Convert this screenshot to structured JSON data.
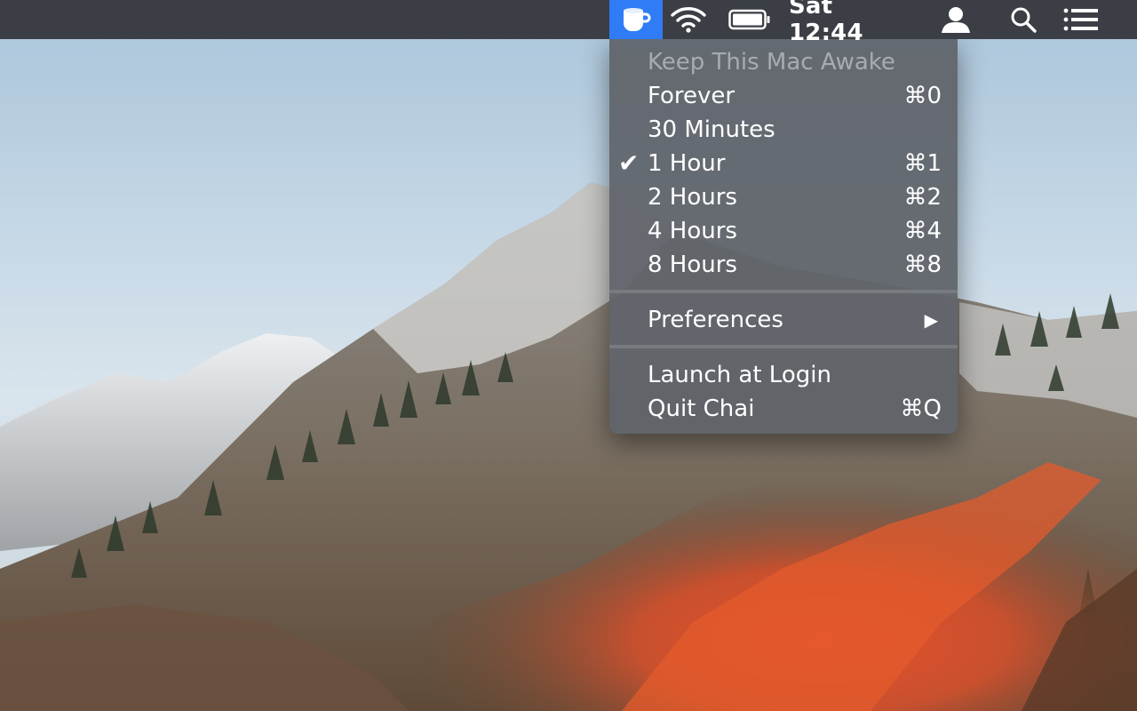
{
  "menubar": {
    "clock": "Sat 12:44",
    "icons": [
      "coffee-cup-icon",
      "wifi-icon",
      "battery-icon",
      "user-icon",
      "search-icon",
      "list-icon"
    ],
    "accent_color": "#2f7cf6"
  },
  "menu": {
    "header": "Keep This Mac Awake",
    "items": [
      {
        "label": "Forever",
        "shortcut": "⌘0",
        "checked": false
      },
      {
        "label": "30 Minutes",
        "shortcut": "",
        "checked": false
      },
      {
        "label": "1 Hour",
        "shortcut": "⌘1",
        "checked": true
      },
      {
        "label": "2 Hours",
        "shortcut": "⌘2",
        "checked": false
      },
      {
        "label": "4 Hours",
        "shortcut": "⌘4",
        "checked": false
      },
      {
        "label": "8 Hours",
        "shortcut": "⌘8",
        "checked": false
      }
    ],
    "preferences": {
      "label": "Preferences",
      "has_submenu": true
    },
    "launch_at_login": {
      "label": "Launch at Login"
    },
    "quit": {
      "label": "Quit Chai",
      "shortcut": "⌘Q"
    },
    "check_mark": "✔",
    "submenu_arrow": "▶"
  }
}
